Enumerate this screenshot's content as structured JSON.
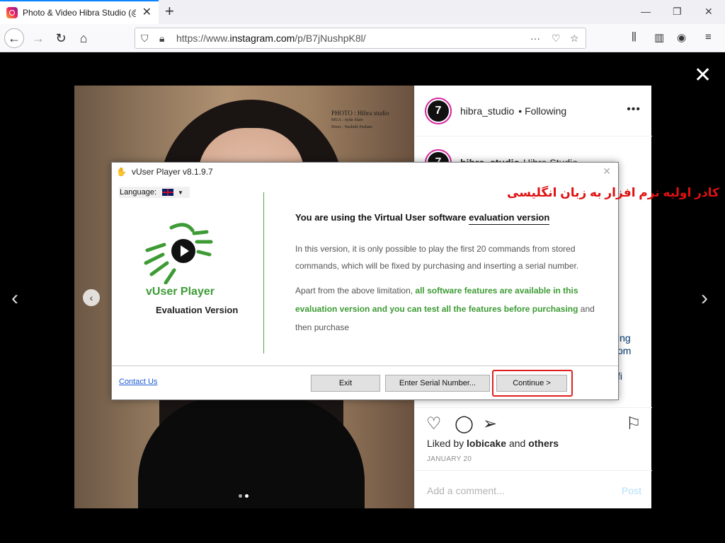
{
  "browser": {
    "tab_title": "Photo & Video Hibra Studio (@",
    "url_prefix": "https://www.",
    "url_domain": "instagram.com",
    "url_path": "/p/B7jNushpK8l/"
  },
  "instagram": {
    "photo_caption": {
      "line1": "PHOTO : Hibra studio",
      "line2": "MUA : Ayda Alaie",
      "line3": "Dress : Nashide Pashaei"
    },
    "username": "hibra_studio",
    "follow_status": "• Following",
    "comment_user": "hibra_studio",
    "comment_text": "Hibra Studio",
    "peek_text_1": "ing",
    "peek_text_2": "om",
    "peek_text_3": "fi",
    "liked_prefix": "Liked by",
    "liked_user": "lobicake",
    "liked_middle": "and",
    "liked_others": "others",
    "date": "JANUARY 20",
    "add_comment_placeholder": "Add a comment...",
    "post_label": "Post"
  },
  "dialog": {
    "title": "vUser Player v8.1.9.7",
    "language_label": "Language:",
    "app_name": "vUser Player",
    "app_edition": "Evaluation Version",
    "heading_prefix": "You are using the Virtual User software",
    "heading_link": "evaluation version",
    "paragraph1": "In this version, it is only possible to play the first 20 commands from stored commands, which will be fixed by purchasing and inserting a serial number.",
    "paragraph2_prefix": "Apart from the above limitation,",
    "paragraph2_highlight": "all software features are available in this evaluation version and you can test all the features before purchasing",
    "paragraph2_suffix": "and then purchase",
    "contact_link": "Contact Us",
    "exit_button": "Exit",
    "serial_button": "Enter Serial Number...",
    "continue_button": "Continue >"
  },
  "annotation_text": "کادر اولیه نرم افزار به زبان انگلیسی",
  "colors": {
    "accent_green": "#3d9b35",
    "annotation_red": "#e01010",
    "link_blue": "#1a5bd6"
  }
}
